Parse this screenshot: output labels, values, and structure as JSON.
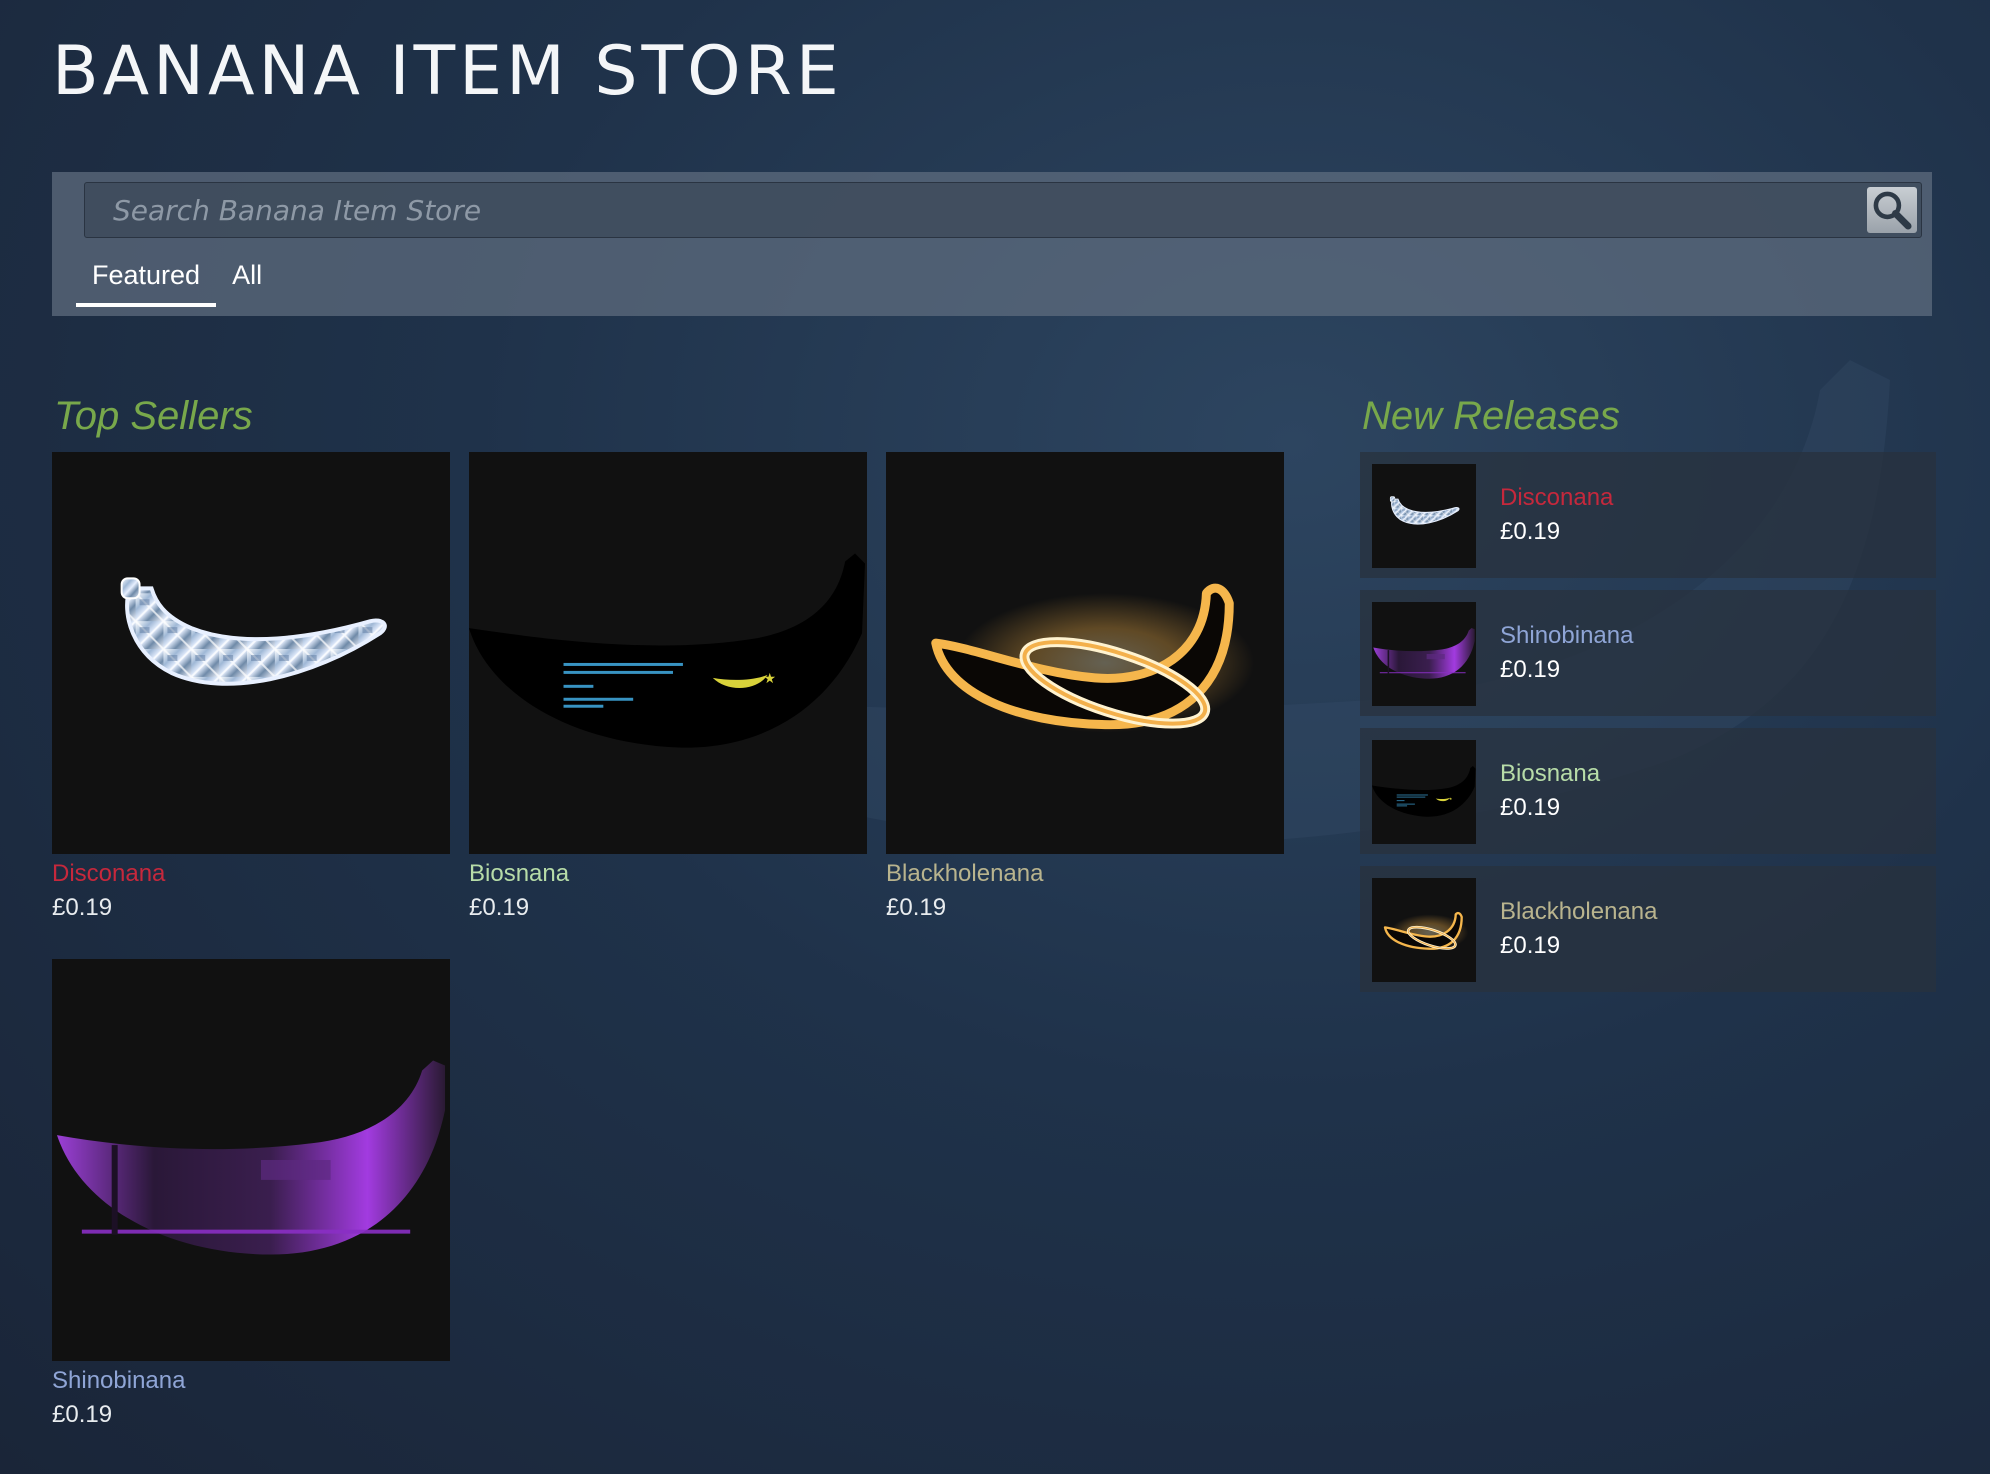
{
  "store": {
    "title": "BANANA ITEM STORE",
    "search_placeholder": "Search Banana Item Store",
    "tabs": [
      {
        "label": "Featured",
        "active": true
      },
      {
        "label": "All",
        "active": false
      }
    ]
  },
  "top_sellers": {
    "heading": "Top Sellers",
    "items": [
      {
        "name": "Disconana",
        "price": "£0.19",
        "name_color": "#c6283c",
        "icon": "crystal-banana-icon"
      },
      {
        "name": "Biosnana",
        "price": "£0.19",
        "name_color": "#b7dca8",
        "icon": "bios-banana-icon"
      },
      {
        "name": "Blackholenana",
        "price": "£0.19",
        "name_color": "#b9b48e",
        "icon": "blackhole-banana-icon"
      },
      {
        "name": "Shinobinana",
        "price": "£0.19",
        "name_color": "#8fa5d6",
        "icon": "shinobi-banana-icon"
      }
    ]
  },
  "new_releases": {
    "heading": "New Releases",
    "items": [
      {
        "name": "Disconana",
        "price": "£0.19",
        "name_color": "#c6283c",
        "icon": "crystal-banana-icon"
      },
      {
        "name": "Shinobinana",
        "price": "£0.19",
        "name_color": "#8fa5d6",
        "icon": "shinobi-banana-icon"
      },
      {
        "name": "Biosnana",
        "price": "£0.19",
        "name_color": "#b7dca8",
        "icon": "bios-banana-icon"
      },
      {
        "name": "Blackholenana",
        "price": "£0.19",
        "name_color": "#b9b48e",
        "icon": "blackhole-banana-icon"
      }
    ]
  },
  "colors": {
    "heading_green": "#78a84b",
    "tile_background": "#111111",
    "nav_bar": "#5f6e80"
  }
}
